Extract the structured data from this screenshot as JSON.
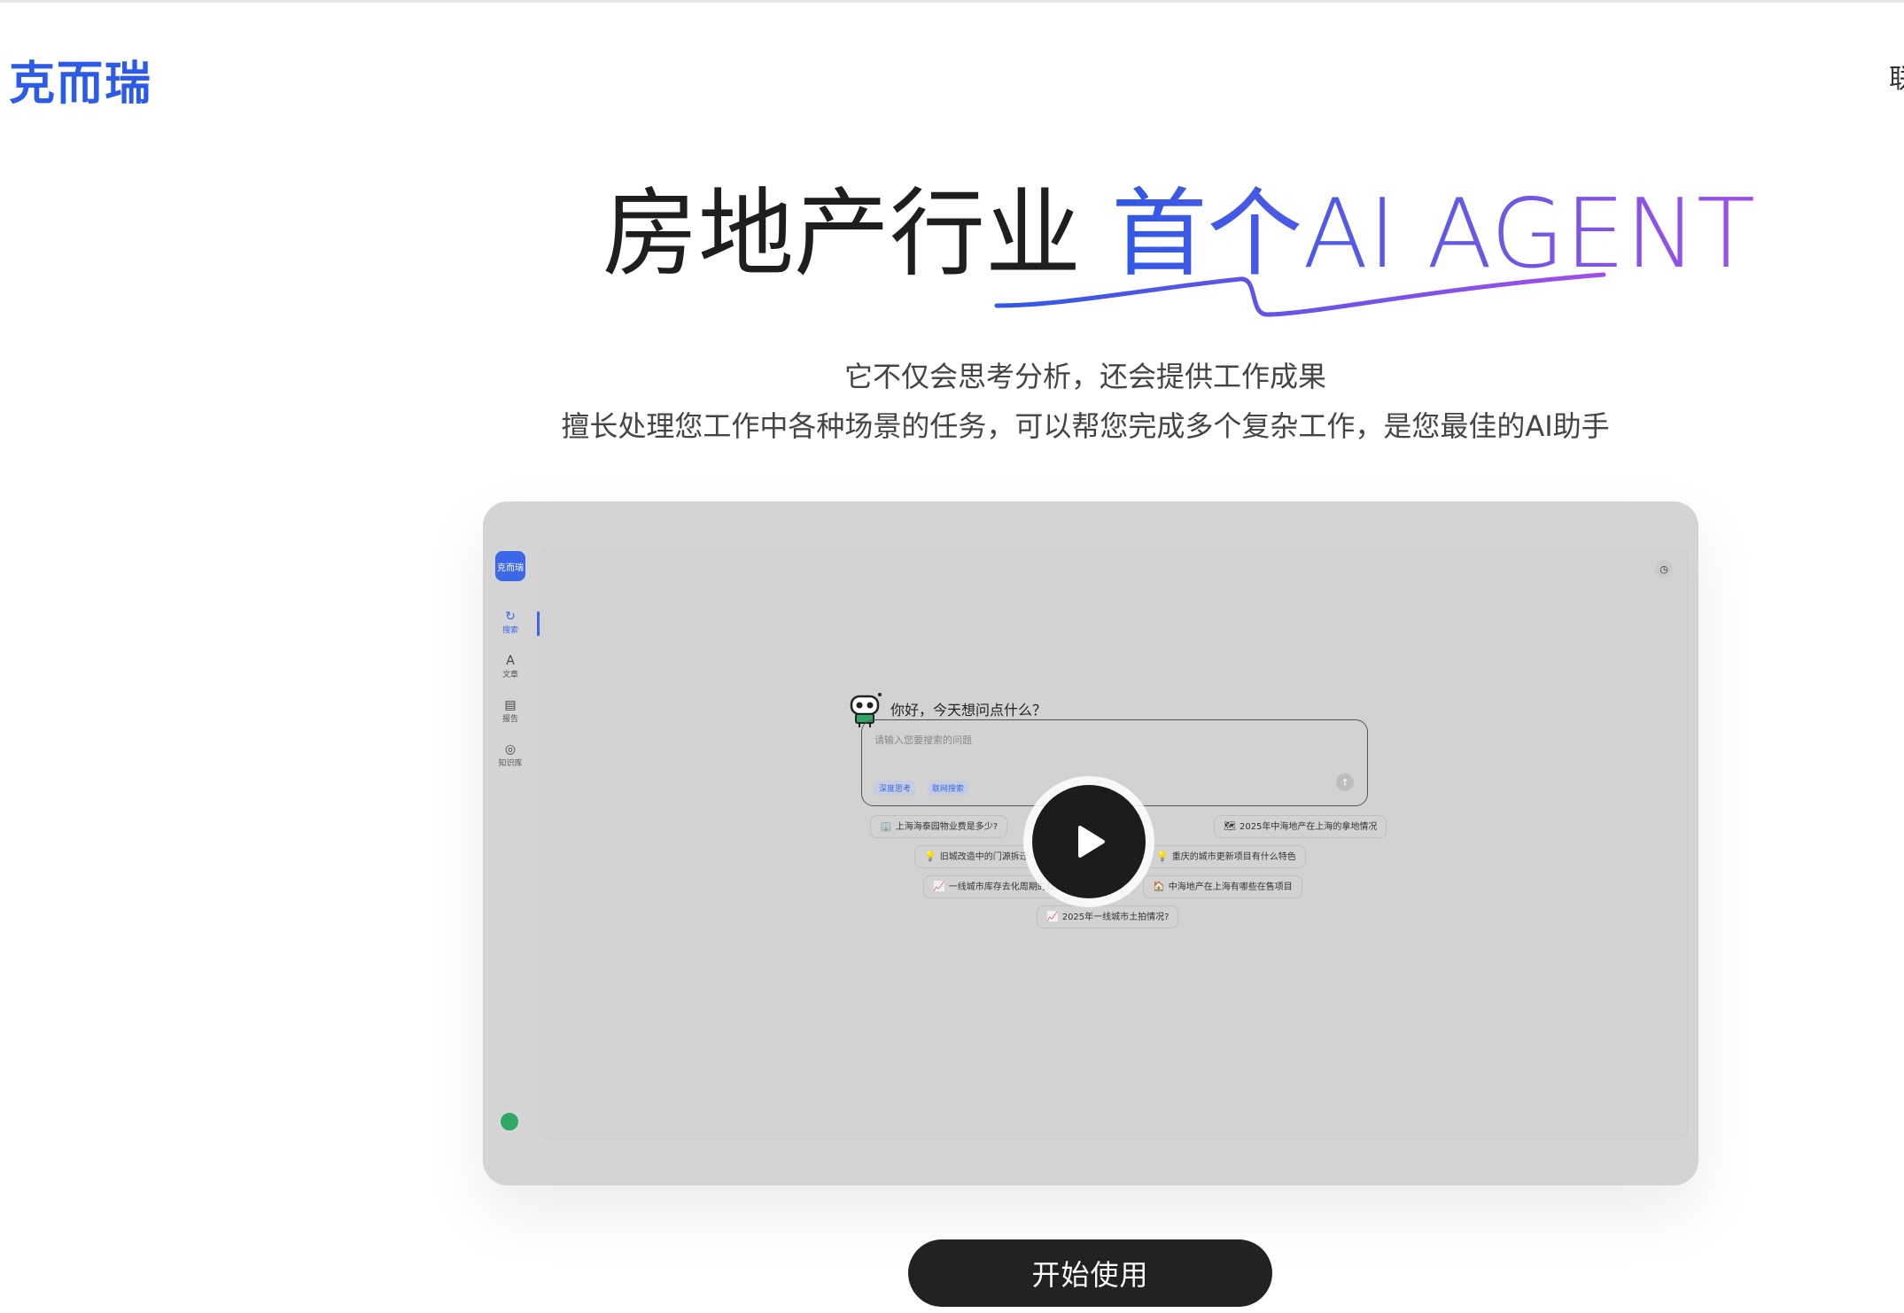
{
  "header": {
    "logo_text": "克而瑞",
    "nav_right_text": "联"
  },
  "hero": {
    "title_plain": "房地产行业 ",
    "title_highlight": "首个AI AGENT",
    "subtitle_line1": "它不仅会思考分析，还会提供工作成果",
    "subtitle_line2": "擅长处理您工作中各种场景的任务，可以帮您完成多个复杂工作，是您最佳的AI助手"
  },
  "preview": {
    "logo_text": "克而瑞",
    "nav": [
      {
        "icon": "↻",
        "label": "搜索"
      },
      {
        "icon": "A",
        "label": "文章"
      },
      {
        "icon": "▤",
        "label": "报告"
      },
      {
        "icon": "◎",
        "label": "知识库"
      }
    ],
    "greeting": "你好，今天想问点什么？",
    "input_placeholder": "请输入您要搜索的问题",
    "chips": [
      "深度思考",
      "联网搜索"
    ],
    "suggestions": [
      {
        "emoji": "🏢",
        "text": "上海海泰园物业费是多少?"
      },
      {
        "emoji": "🗺",
        "text": "2025年中海地产在上海的拿地情况"
      },
      {
        "emoji": "💡",
        "text": "旧城改造中的门源拆迁"
      },
      {
        "emoji": "💡",
        "text": "重庆的城市更新项目有什么特色"
      },
      {
        "emoji": "📈",
        "text": "一线城市库存去化周期的数据是多少?"
      },
      {
        "emoji": "🏠",
        "text": "中海地产在上海有哪些在售项目"
      },
      {
        "emoji": "📈",
        "text": "2025年一线城市土拍情况?"
      }
    ]
  },
  "cta": {
    "start_label": "开始使用"
  },
  "colors": {
    "brand_blue": "#2b5be7",
    "gradient_start": "#3158e6",
    "gradient_end": "#a04fe8",
    "button_dark": "#222222"
  }
}
